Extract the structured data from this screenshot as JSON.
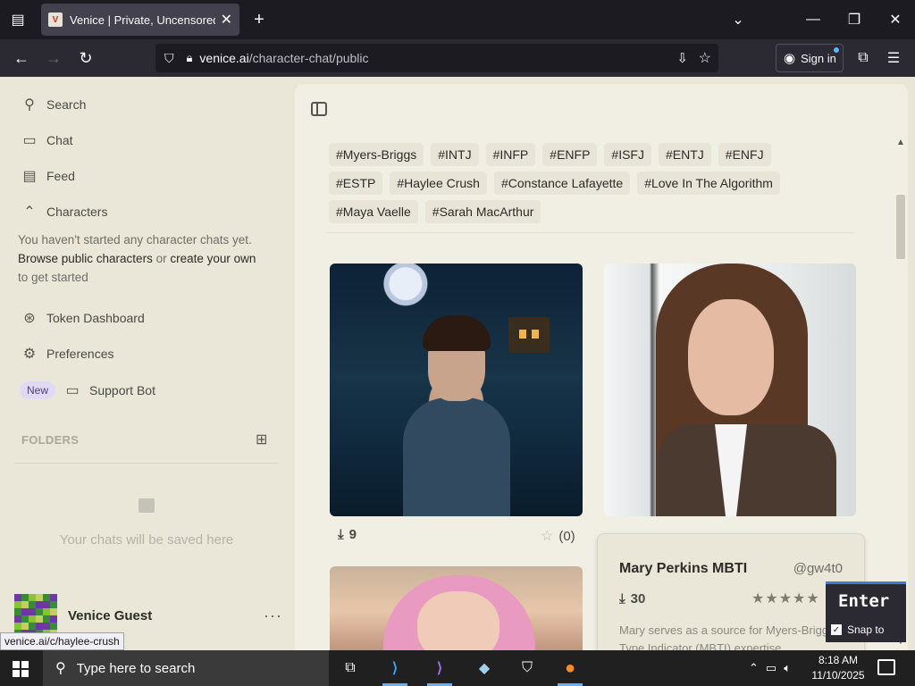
{
  "browser": {
    "tab_title": "Venice | Private, Uncensored AI",
    "tab_close": "✕",
    "new_tab": "+",
    "url_host": "venice.ai",
    "url_path": "/character-chat/public",
    "sign_in": "Sign in"
  },
  "sidebar": {
    "search": "Search",
    "chat": "Chat",
    "feed": "Feed",
    "characters": "Characters",
    "no_chats_line1": "You haven't started any character chats yet.",
    "browse_link": "Browse public characters",
    "or_text": " or ",
    "create_link": "create your own",
    "to_get_started": "to get started",
    "token_dashboard": "Token Dashboard",
    "preferences": "Preferences",
    "new_badge": "New",
    "support_bot": "Support Bot",
    "folders": "FOLDERS",
    "empty_chats": "Your chats will be saved here",
    "guest_name": "Venice Guest",
    "more": "···"
  },
  "status_url": "venice.ai/c/haylee-crush",
  "tags": [
    "#Myers-Briggs",
    "#INTJ",
    "#INFP",
    "#ENFP",
    "#ISFJ",
    "#ENTJ",
    "#ENFJ",
    "#ESTP",
    "#Haylee Crush",
    "#Constance Lafayette",
    "#Love In The Algorithm",
    "#Maya Vaelle",
    "#Sarah MacArthur"
  ],
  "cards": {
    "card1": {
      "downloads": "9",
      "rating": "(0)"
    },
    "popover": {
      "name": "Mary Perkins MBTI",
      "handle": "@gw4t0",
      "downloads": "30",
      "stars": "★★★★★",
      "description": "Mary serves as a source for Myers-Briggs Type Indicator (MBTI) expertise,"
    }
  },
  "overlay": {
    "key": "Enter",
    "snap": "Snap to"
  },
  "taskbar": {
    "search_placeholder": "Type here to search",
    "time": "8:18 AM",
    "date": "11/10/2025"
  }
}
